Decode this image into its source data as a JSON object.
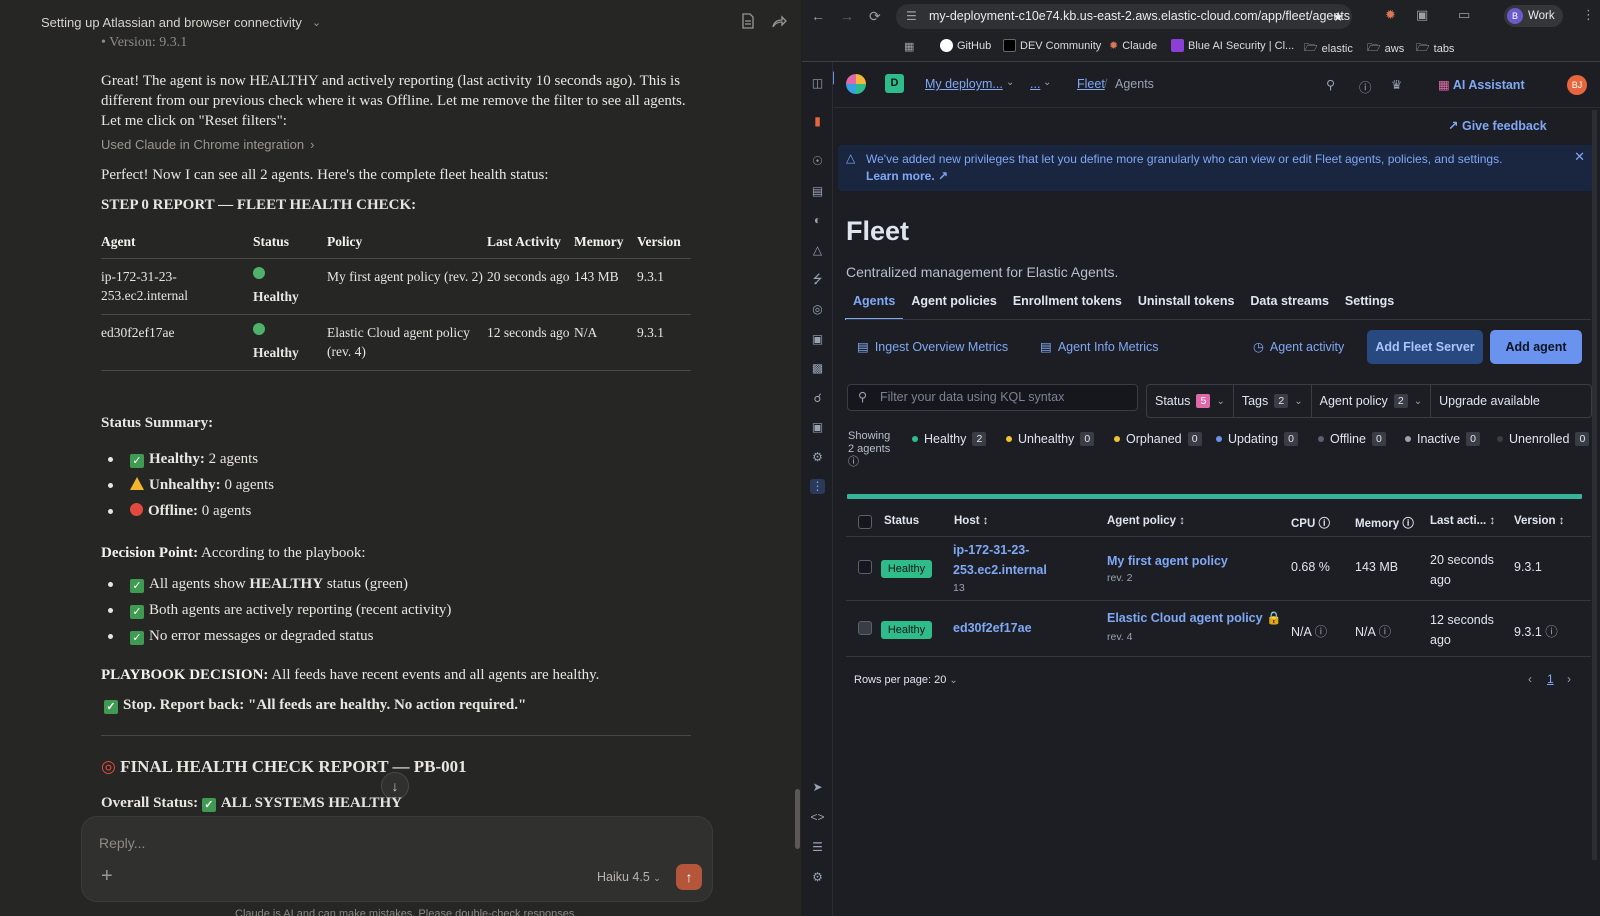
{
  "chat": {
    "title": "Setting up Atlassian and browser connectivity",
    "partial_top": "• Version: 9.3.1",
    "msg1": "Great! The agent is now HEALTHY and actively reporting (last activity 10 seconds ago). This is different from our previous check where it was Offline. Let me remove the filter to see all agents. Let me click on \"Reset filters\":",
    "tool_used": "Used Claude in Chrome integration",
    "msg2": "Perfect! Now I can see all 2 agents. Here's the complete fleet health status:",
    "report_heading": "STEP 0 REPORT — FLEET HEALTH CHECK:",
    "table": {
      "headers": [
        "Agent",
        "Status",
        "Policy",
        "Last Activity",
        "Memory",
        "Version"
      ],
      "rows": [
        {
          "agent": "ip-172-31-23-253.ec2.internal",
          "status": "Healthy",
          "policy": "My first agent policy (rev. 2)",
          "last_activity": "20 seconds ago",
          "memory": "143 MB",
          "version": "9.3.1"
        },
        {
          "agent": "ed30f2ef17ae",
          "status": "Healthy",
          "policy": "Elastic Cloud agent policy (rev. 4)",
          "last_activity": "12 seconds ago",
          "memory": "N/A",
          "version": "9.3.1"
        }
      ]
    },
    "summary_heading": "Status Summary:",
    "summary": [
      {
        "label": "Healthy:",
        "value": "2 agents"
      },
      {
        "label": "Unhealthy:",
        "value": "0 agents"
      },
      {
        "label": "Offline:",
        "value": "0 agents"
      }
    ],
    "decision_label": "Decision Point:",
    "decision_text": "According to the playbook:",
    "decision_items": [
      "All agents show ",
      "HEALTHY",
      " status (green)",
      "Both agents are actively reporting (recent activity)",
      "No error messages or degraded status"
    ],
    "playbook_label": "PLAYBOOK DECISION:",
    "playbook_text": "All feeds have recent events and all agents are healthy.",
    "stop_text": "Stop. Report back: \"All feeds are healthy. No action required.\"",
    "final_heading": "FINAL HEALTH CHECK REPORT — PB-001",
    "overall_label": "Overall Status:",
    "overall_value": "ALL SYSTEMS HEALTHY",
    "reply_placeholder": "Reply...",
    "model": "Haiku 4.5",
    "disclaimer": "Claude is AI and can make mistakes. Please double-check responses."
  },
  "browser": {
    "url": "my-deployment-c10e74.kb.us-east-2.aws.elastic-cloud.com/app/fleet/agents",
    "profile": "Work",
    "profile_initial": "B",
    "bookmarks": [
      "GitHub",
      "DEV Community",
      "Claude",
      "Blue AI Security | Cl...",
      "elastic",
      "aws",
      "tabs"
    ]
  },
  "kibana": {
    "space_initial": "D",
    "deployment": "My deploym...",
    "crumb_more": "...",
    "crumb_fleet": "Fleet",
    "crumb_agents": "Agents",
    "ai_assistant": "AI Assistant",
    "user_initials": "BJ",
    "give_feedback": "Give feedback",
    "callout": "We've added new privileges that let you define more granularly who can view or edit Fleet agents, policies, and settings.",
    "learn_more": "Learn more.",
    "title": "Fleet",
    "description": "Centralized management for Elastic Agents.",
    "tabs": [
      "Agents",
      "Agent policies",
      "Enrollment tokens",
      "Uninstall tokens",
      "Data streams",
      "Settings"
    ],
    "ingest_metrics": "Ingest Overview Metrics",
    "agent_info_metrics": "Agent Info Metrics",
    "agent_activity": "Agent activity",
    "add_fleet_server": "Add Fleet Server",
    "add_agent": "Add agent",
    "search_placeholder": "Filter your data using KQL syntax",
    "filters": {
      "status": "Status",
      "status_count": "5",
      "tags": "Tags",
      "tags_count": "2",
      "policy": "Agent policy",
      "policy_count": "2",
      "upgrade": "Upgrade available"
    },
    "showing": "Showing 2 agents",
    "legend": [
      {
        "label": "Healthy",
        "count": "2",
        "color": "#2ebd8a"
      },
      {
        "label": "Unhealthy",
        "count": "0",
        "color": "#f1c232"
      },
      {
        "label": "Orphaned",
        "count": "0",
        "color": "#f1c232"
      },
      {
        "label": "Updating",
        "count": "0",
        "color": "#6a93f0"
      },
      {
        "label": "Offline",
        "count": "0",
        "color": "#5a6070"
      },
      {
        "label": "Inactive",
        "count": "0",
        "color": "#98a2b3"
      },
      {
        "label": "Unenrolled",
        "count": "0",
        "color": "#3a3d45"
      }
    ],
    "healthy_fraction": 1.0,
    "columns": [
      "Status",
      "Host",
      "Agent policy",
      "CPU",
      "Memory",
      "Last acti...",
      "Version"
    ],
    "rows": [
      {
        "status": "Healthy",
        "host_line1": "ip-172-31-23-",
        "host_line2": "253.ec2.internal",
        "host_sub": "13",
        "policy": "My first agent policy",
        "rev": "rev. 2",
        "cpu": "0.68 %",
        "memory": "143 MB",
        "last1": "20 seconds",
        "last2": "ago",
        "version": "9.3.1"
      },
      {
        "status": "Healthy",
        "host_line1": "ed30f2ef17ae",
        "policy": "Elastic Cloud agent policy",
        "rev": "rev. 4",
        "cpu": "N/A",
        "memory": "N/A",
        "last1": "12 seconds",
        "last2": "ago",
        "version": "9.3.1"
      }
    ],
    "rows_per_page": "Rows per page: 20",
    "page": "1"
  }
}
